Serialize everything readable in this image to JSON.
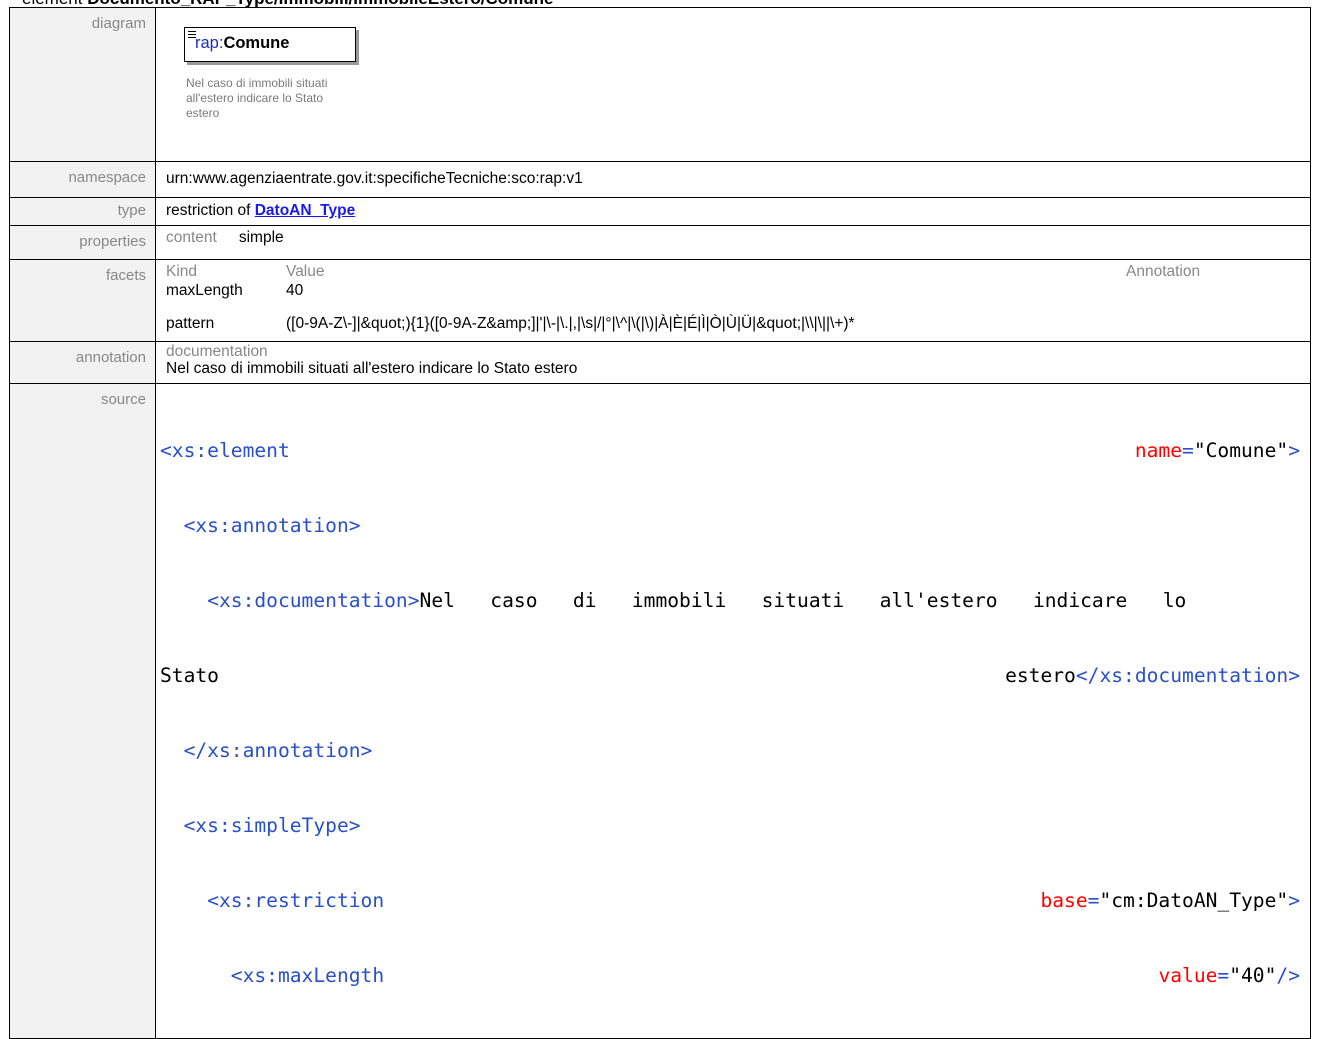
{
  "heading": {
    "prefix": "element ",
    "name": "Documento_RAP_Type/Immobili/ImmobileEstero/Comune"
  },
  "rows": {
    "diagram_label": "diagram",
    "namespace_label": "namespace",
    "type_label": "type",
    "properties_label": "properties",
    "facets_label": "facets",
    "annotation_label": "annotation",
    "source_label": "source"
  },
  "diagram": {
    "element_prefix": "rap:",
    "element_name": "Comune",
    "documentation": "Nel caso di immobili situati all'estero indicare lo Stato estero"
  },
  "namespace": "urn:www.agenziaentrate.gov.it:specificheTecniche:sco:rap:v1",
  "type": {
    "prefix": "restriction of ",
    "link": "DatoAN_Type"
  },
  "properties": {
    "key": "content",
    "value": "simple"
  },
  "facets": {
    "headers": {
      "kind": "Kind",
      "value": "Value",
      "annotation": "Annotation"
    },
    "rows": [
      {
        "kind": "maxLength",
        "value": "40"
      },
      {
        "kind": "pattern",
        "value": "([0-9A-Z\\-]|&quot;){1}([0-9A-Z&amp;]|'|\\-|\\.|,|\\s|/|°|\\^|\\(|\\)|À|È|É|Ì|Ò|Ù|Ü|&quot;|\\\\|\\||\\+)*"
      }
    ]
  },
  "annotation": {
    "head": "documentation",
    "text": "Nel caso di immobili situati all'estero indicare lo Stato estero"
  },
  "source": {
    "l1_tag": "<xs:element",
    "l1_attr": "name",
    "l1_val": "\"Comune\"",
    "l1_close": ">",
    "l2": "<xs:annotation>",
    "l3_open": "<xs:documentation>",
    "l3_text": "Nel   caso   di   immobili   situati   all'estero   indicare   lo",
    "l4_left": "Stato",
    "l4_text": "estero",
    "l4_close": "</xs:documentation>",
    "l5": "</xs:annotation>",
    "l6": "<xs:simpleType>",
    "l7_tag": "<xs:restriction",
    "l7_attr": "base",
    "l7_val": "\"cm:DatoAN_Type\"",
    "l7_close": ">",
    "l8_tag": "<xs:maxLength",
    "l8_attr": "value",
    "l8_val": "\"40\"",
    "l8_close": "/>"
  }
}
